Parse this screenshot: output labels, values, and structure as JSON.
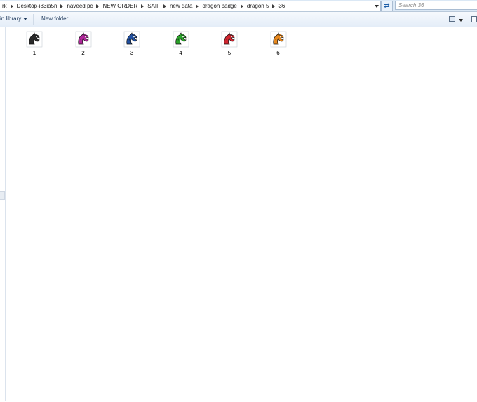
{
  "address_bar": {
    "crumbs": [
      "rk",
      "Desktop-i83ia5n",
      "naveed pc",
      "NEW ORDER",
      "SAIF",
      "new data",
      "dragon badge",
      "dragon 5",
      "36"
    ]
  },
  "search": {
    "placeholder": "Search 36"
  },
  "toolbar": {
    "include_library_label": "in library",
    "new_folder_label": "New folder"
  },
  "files": [
    {
      "name": "1",
      "color": "#2a2a2a"
    },
    {
      "name": "2",
      "color": "#b0289a"
    },
    {
      "name": "3",
      "color": "#1f4fa0"
    },
    {
      "name": "4",
      "color": "#2aa32a"
    },
    {
      "name": "5",
      "color": "#d0252f"
    },
    {
      "name": "6",
      "color": "#e8891e"
    }
  ]
}
